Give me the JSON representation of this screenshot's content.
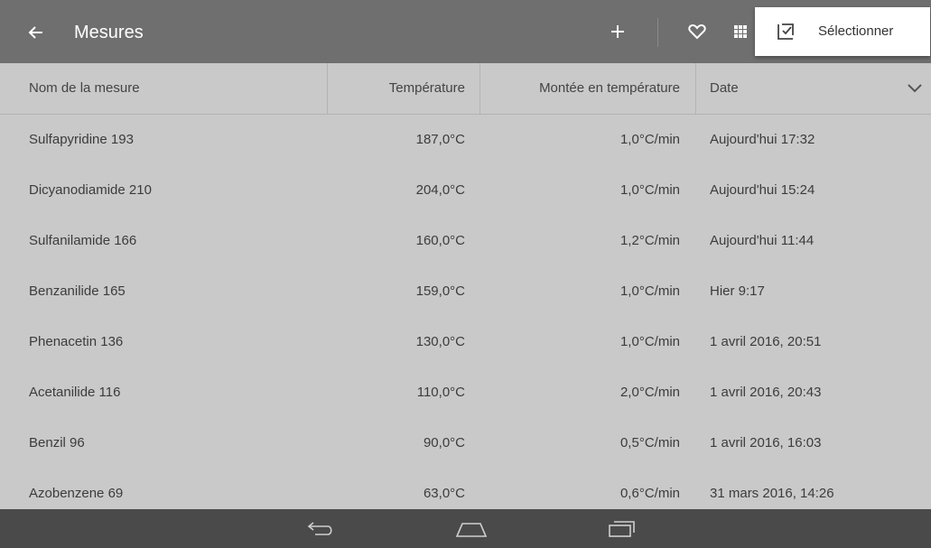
{
  "appbar": {
    "title": "Mesures",
    "back_icon": "arrow-back-icon",
    "add_icon": "plus-icon",
    "favorite_icon": "heart-outline-icon",
    "grid_icon": "grid-icon",
    "background": "#6f6f6f"
  },
  "overflow_menu": {
    "items": [
      {
        "label": "Sélectionner",
        "icon": "select-checkbox-icon"
      }
    ]
  },
  "table": {
    "columns": [
      "Nom de la mesure",
      "Température",
      "Montée en température",
      "Date"
    ],
    "sort_icon": "chevron-down-icon",
    "rows": [
      [
        "Sulfapyridine 193",
        "187,0°C",
        "1,0°C/min",
        "Aujourd'hui 17:32"
      ],
      [
        "Dicyanodiamide 210",
        "204,0°C",
        "1,0°C/min",
        "Aujourd'hui 15:24"
      ],
      [
        "Sulfanilamide 166",
        "160,0°C",
        "1,2°C/min",
        "Aujourd'hui 11:44"
      ],
      [
        "Benzanilide 165",
        "159,0°C",
        "1,0°C/min",
        "Hier 9:17"
      ],
      [
        "Phenacetin 136",
        "130,0°C",
        "1,0°C/min",
        "1 avril 2016, 20:51"
      ],
      [
        "Acetanilide 116",
        "110,0°C",
        "2,0°C/min",
        "1 avril 2016, 20:43"
      ],
      [
        "Benzil 96",
        "90,0°C",
        "0,5°C/min",
        "1 avril 2016, 16:03"
      ],
      [
        "Azobenzene 69",
        "63,0°C",
        "0,6°C/min",
        "31 mars 2016, 14:26"
      ]
    ]
  },
  "navbar": {
    "icons": [
      "nav-back-icon",
      "nav-home-icon",
      "nav-recents-icon"
    ],
    "background": "#4a4a4a"
  }
}
